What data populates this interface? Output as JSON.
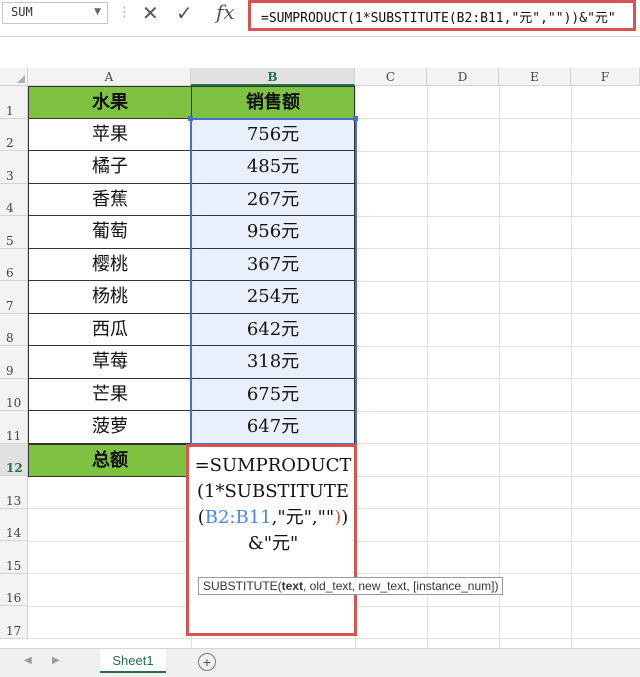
{
  "formula_bar": {
    "name_box": "SUM",
    "cancel_icon": "✕",
    "enter_icon": "✓",
    "fx_label": "fx",
    "formula": "=SUMPRODUCT(1*SUBSTITUTE(B2:B11,\"元\",\"\"))&\"元\""
  },
  "columns": [
    "A",
    "B",
    "C",
    "D",
    "E",
    "F"
  ],
  "rows": [
    "1",
    "2",
    "3",
    "4",
    "5",
    "6",
    "7",
    "8",
    "9",
    "10",
    "11",
    "12",
    "13",
    "14",
    "15",
    "16",
    "17"
  ],
  "table": {
    "header": {
      "fruit": "水果",
      "sales": "销售额"
    },
    "rows": [
      {
        "fruit": "苹果",
        "sales": "756元"
      },
      {
        "fruit": "橘子",
        "sales": "485元"
      },
      {
        "fruit": "香蕉",
        "sales": "267元"
      },
      {
        "fruit": "葡萄",
        "sales": "956元"
      },
      {
        "fruit": "樱桃",
        "sales": "367元"
      },
      {
        "fruit": "杨桃",
        "sales": "254元"
      },
      {
        "fruit": "西瓜",
        "sales": "642元"
      },
      {
        "fruit": "草莓",
        "sales": "318元"
      },
      {
        "fruit": "芒果",
        "sales": "675元"
      },
      {
        "fruit": "菠萝",
        "sales": "647元"
      }
    ],
    "total_label": "总额"
  },
  "edit_cell": {
    "part1": "=SUMPRODUCT(1*SUBSTITUTE(",
    "ref": "B2:B11",
    "part2": ",\"元\",\"\"",
    "close_paren": ")",
    "part3": ")&\"元\""
  },
  "tooltip": {
    "func": "SUBSTITUTE(",
    "arg1": "text",
    "rest": ", old_text, new_text, [instance_num])"
  },
  "sheet_tabs": {
    "active": "Sheet1",
    "add": "+"
  },
  "colors": {
    "header_green": "#7fc242",
    "selection_blue": "#4472c4",
    "highlight_red": "#d9534f",
    "sales_fill": "#eaf0fb"
  }
}
